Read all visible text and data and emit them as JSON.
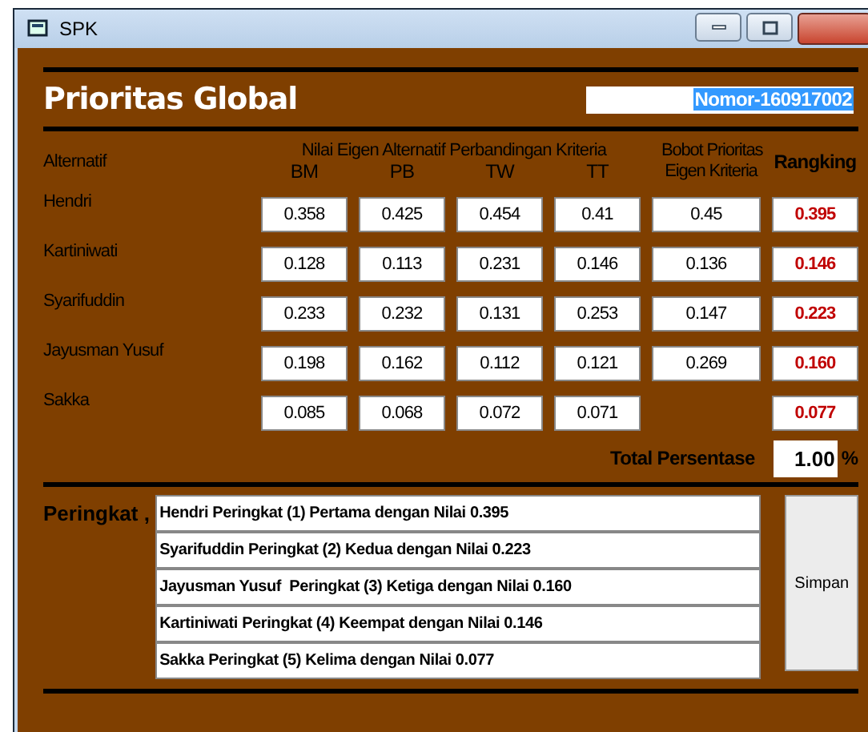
{
  "window": {
    "title": "SPK"
  },
  "heading": "Prioritas Global",
  "nomor_field": {
    "value": "Nomor-160917002",
    "text_selected": true
  },
  "table": {
    "name_header": "Alternatif",
    "group_header": "Nilai Eigen Alternatif Perbandingan Kriteria",
    "criteria": [
      "BM",
      "PB",
      "TW",
      "TT"
    ],
    "weight_header": [
      "Bobot Prioritas",
      "Eigen Kriteria"
    ],
    "rank_header": "Rangking",
    "rows": [
      {
        "name": "Hendri",
        "values": [
          "0.358",
          "0.425",
          "0.454",
          "0.41"
        ],
        "weight": "0.45",
        "rank": "0.395"
      },
      {
        "name": "Kartiniwati",
        "values": [
          "0.128",
          "0.113",
          "0.231",
          "0.146"
        ],
        "weight": "0.136",
        "rank": "0.146"
      },
      {
        "name": "Syarifuddin",
        "values": [
          "0.233",
          "0.232",
          "0.131",
          "0.253"
        ],
        "weight": "0.147",
        "rank": "0.223"
      },
      {
        "name": "Jayusman Yusuf",
        "values": [
          "0.198",
          "0.162",
          "0.112",
          "0.121"
        ],
        "weight": "0.269",
        "rank": "0.160"
      },
      {
        "name": "Sakka",
        "values": [
          "0.085",
          "0.068",
          "0.072",
          "0.071"
        ],
        "rank": "0.077"
      }
    ]
  },
  "total": {
    "label": "Total Persentase",
    "value": "1.00",
    "unit": "%"
  },
  "ranking": {
    "label": "Peringkat ,",
    "lines": [
      "Hendri Peringkat (1) Pertama dengan Nilai 0.395",
      "Syarifuddin Peringkat (2) Kedua dengan Nilai 0.223",
      "Jayusman Yusuf  Peringkat (3) Ketiga dengan Nilai 0.160",
      "Kartiniwati Peringkat (4) Keempat dengan Nilai 0.146",
      "Sakka Peringkat (5) Kelima dengan Nilai 0.077"
    ]
  },
  "save_button": "Simpan"
}
